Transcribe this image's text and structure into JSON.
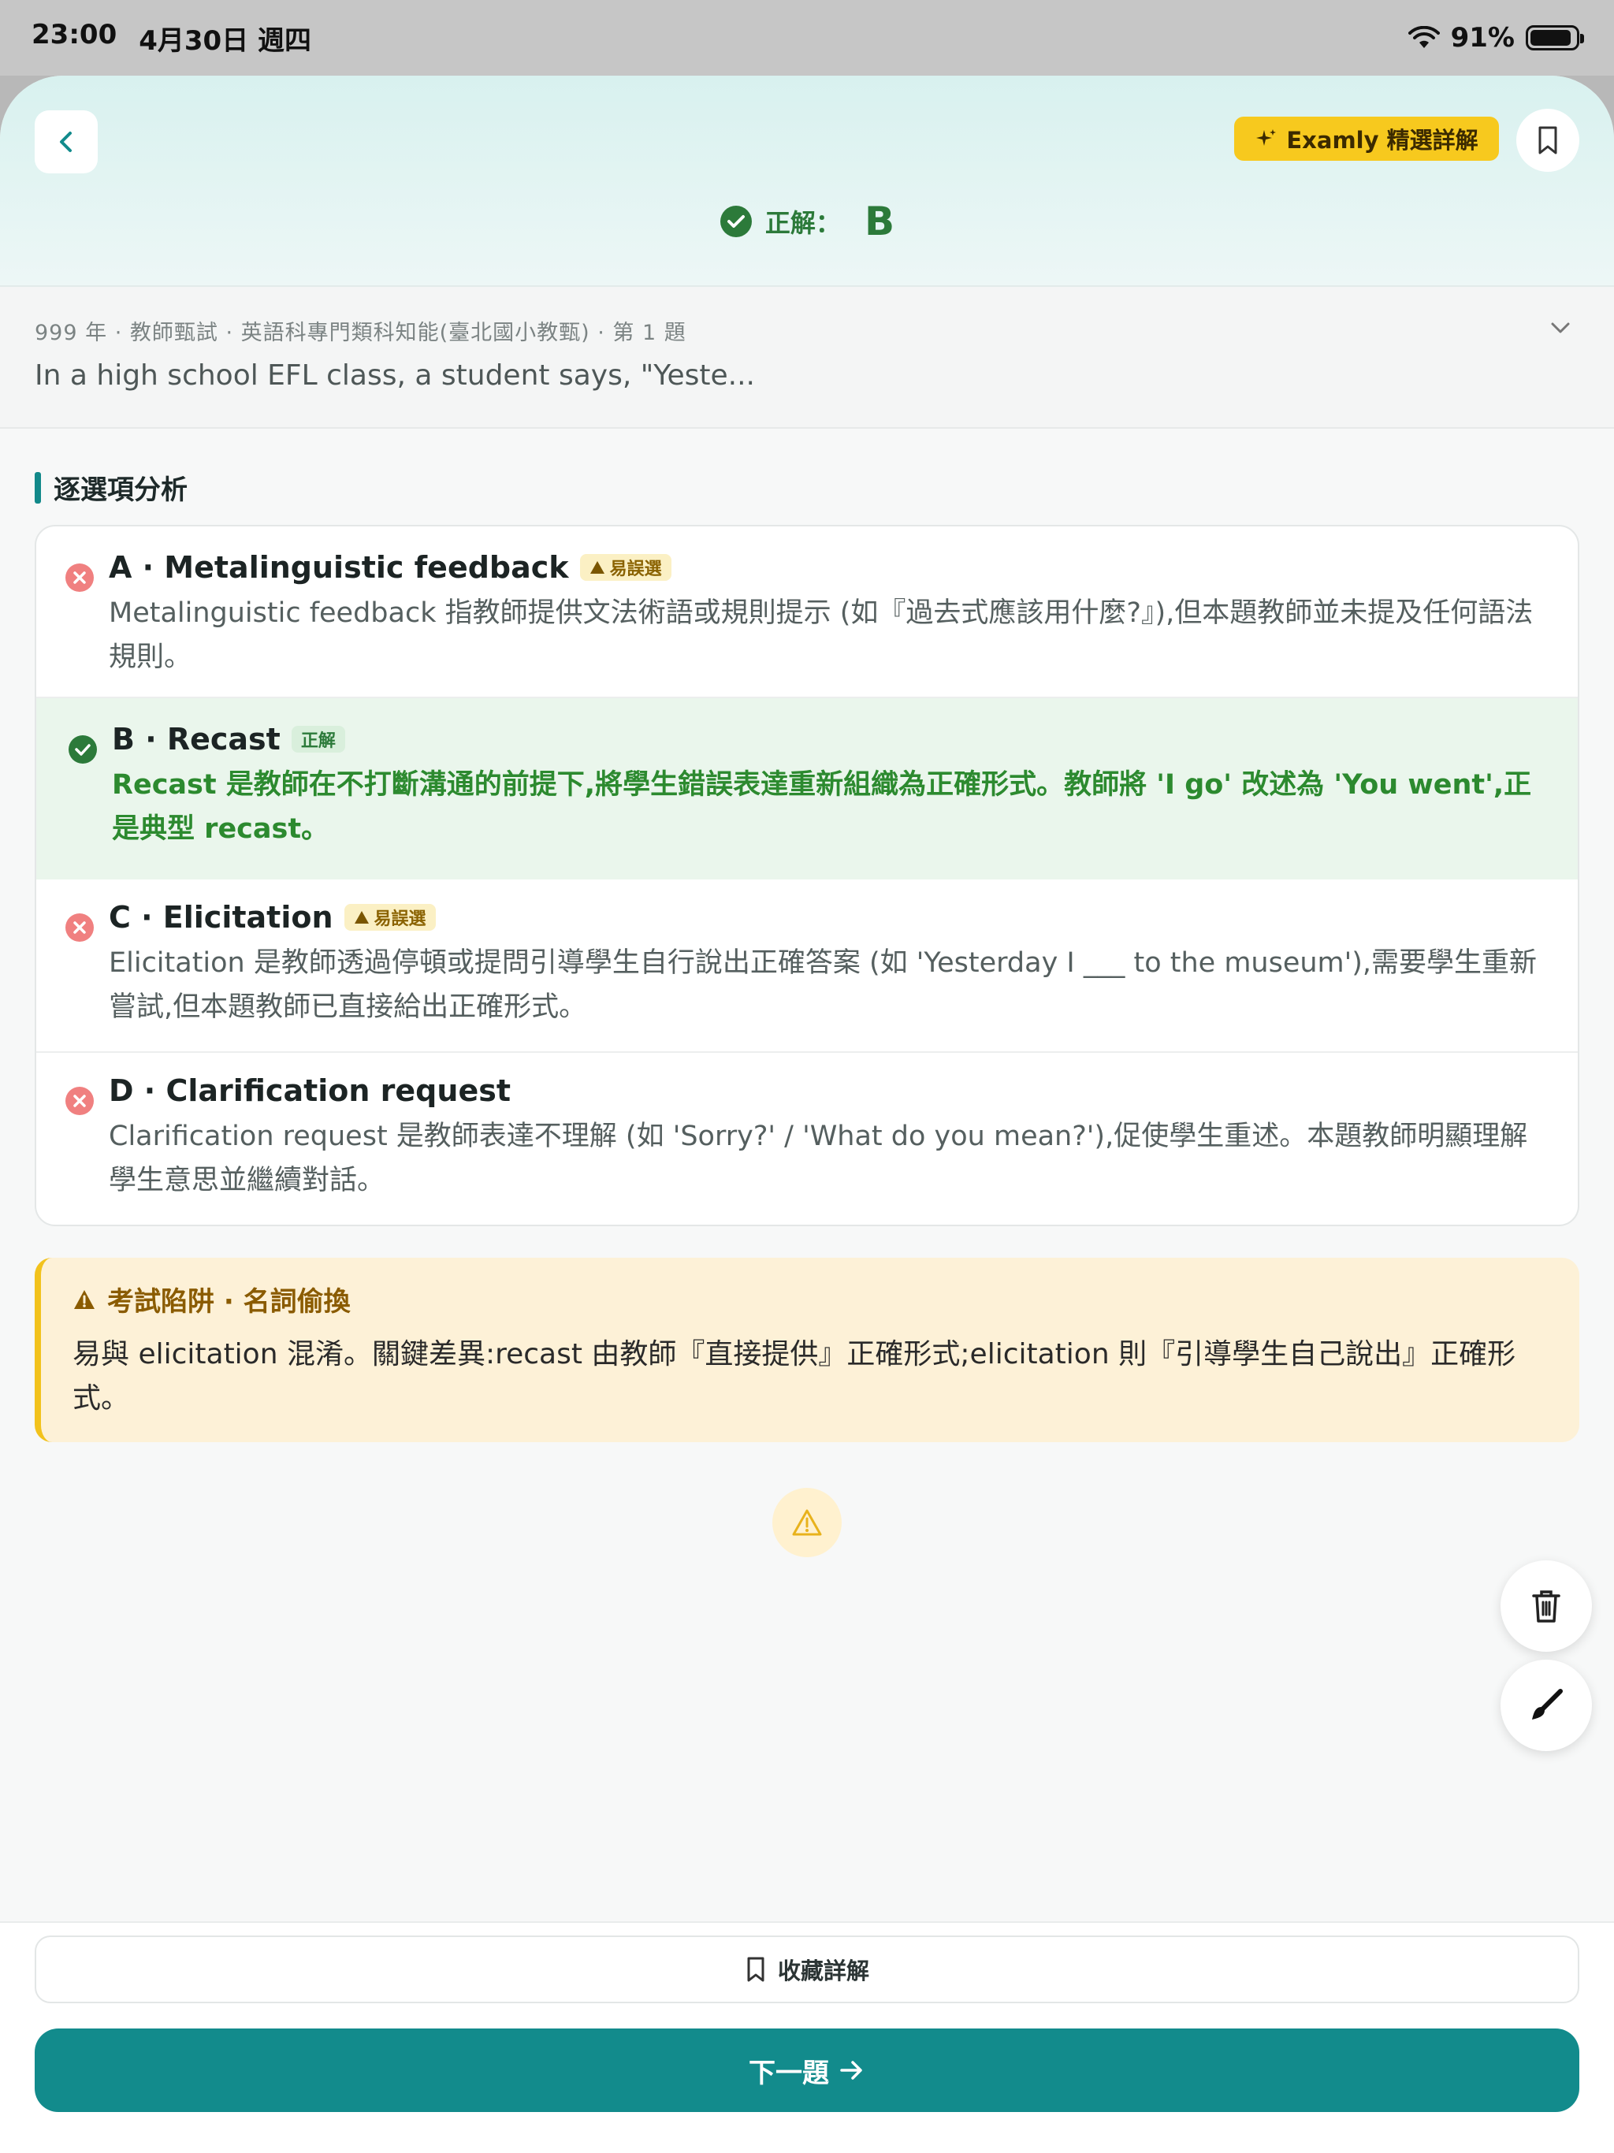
{
  "status_bar": {
    "time": "23:00",
    "date": "4月30日 週四",
    "battery": "91%",
    "battery_level": 0.91
  },
  "header": {
    "examly_label": "Examly 精選詳解",
    "answer_label": "正解：",
    "answer_value": "B"
  },
  "question": {
    "meta": "999 年 · 教師甄試 · 英語科專門類科知能(臺北國小教甄) · 第 1 題",
    "text": "In a high school EFL class, a student says, \"Yeste..."
  },
  "analysis": {
    "title": "逐選項分析",
    "options": [
      {
        "title": "A · Metalinguistic feedback",
        "tag": "易誤選",
        "body": "Metalinguistic feedback 指教師提供文法術語或規則提示 (如『過去式應該用什麼?』),但本題教師並未提及任何語法規則。"
      },
      {
        "title": "B · Recast",
        "tag": "正解",
        "body": "Recast 是教師在不打斷溝通的前提下,將學生錯誤表達重新組織為正確形式。教師將 'I go' 改述為 'You went',正是典型 recast。"
      },
      {
        "title": "C · Elicitation",
        "tag": "易誤選",
        "body": "Elicitation 是教師透過停頓或提問引導學生自行說出正確答案 (如 'Yesterday I ___ to the museum'),需要學生重新嘗試,但本題教師已直接給出正確形式。"
      },
      {
        "title": "D · Clarification request",
        "body": "Clarification request 是教師表達不理解 (如 'Sorry?' / 'What do you mean?'),促使學生重述。本題教師明顯理解學生意思並繼續對話。"
      }
    ]
  },
  "trap": {
    "title": "考試陷阱 · 名詞偷換",
    "body": "易與 elicitation 混淆。關鍵差異:recast 由教師『直接提供』正確形式;elicitation 則『引導學生自己說出』正確形式。"
  },
  "bottom": {
    "save_label": "收藏詳解",
    "next_label": "下一題"
  },
  "colors": {
    "accent": "#128b8c",
    "correct": "#2c8a2f",
    "wrong": "#e94f4f",
    "warning": "#f2c21c"
  }
}
